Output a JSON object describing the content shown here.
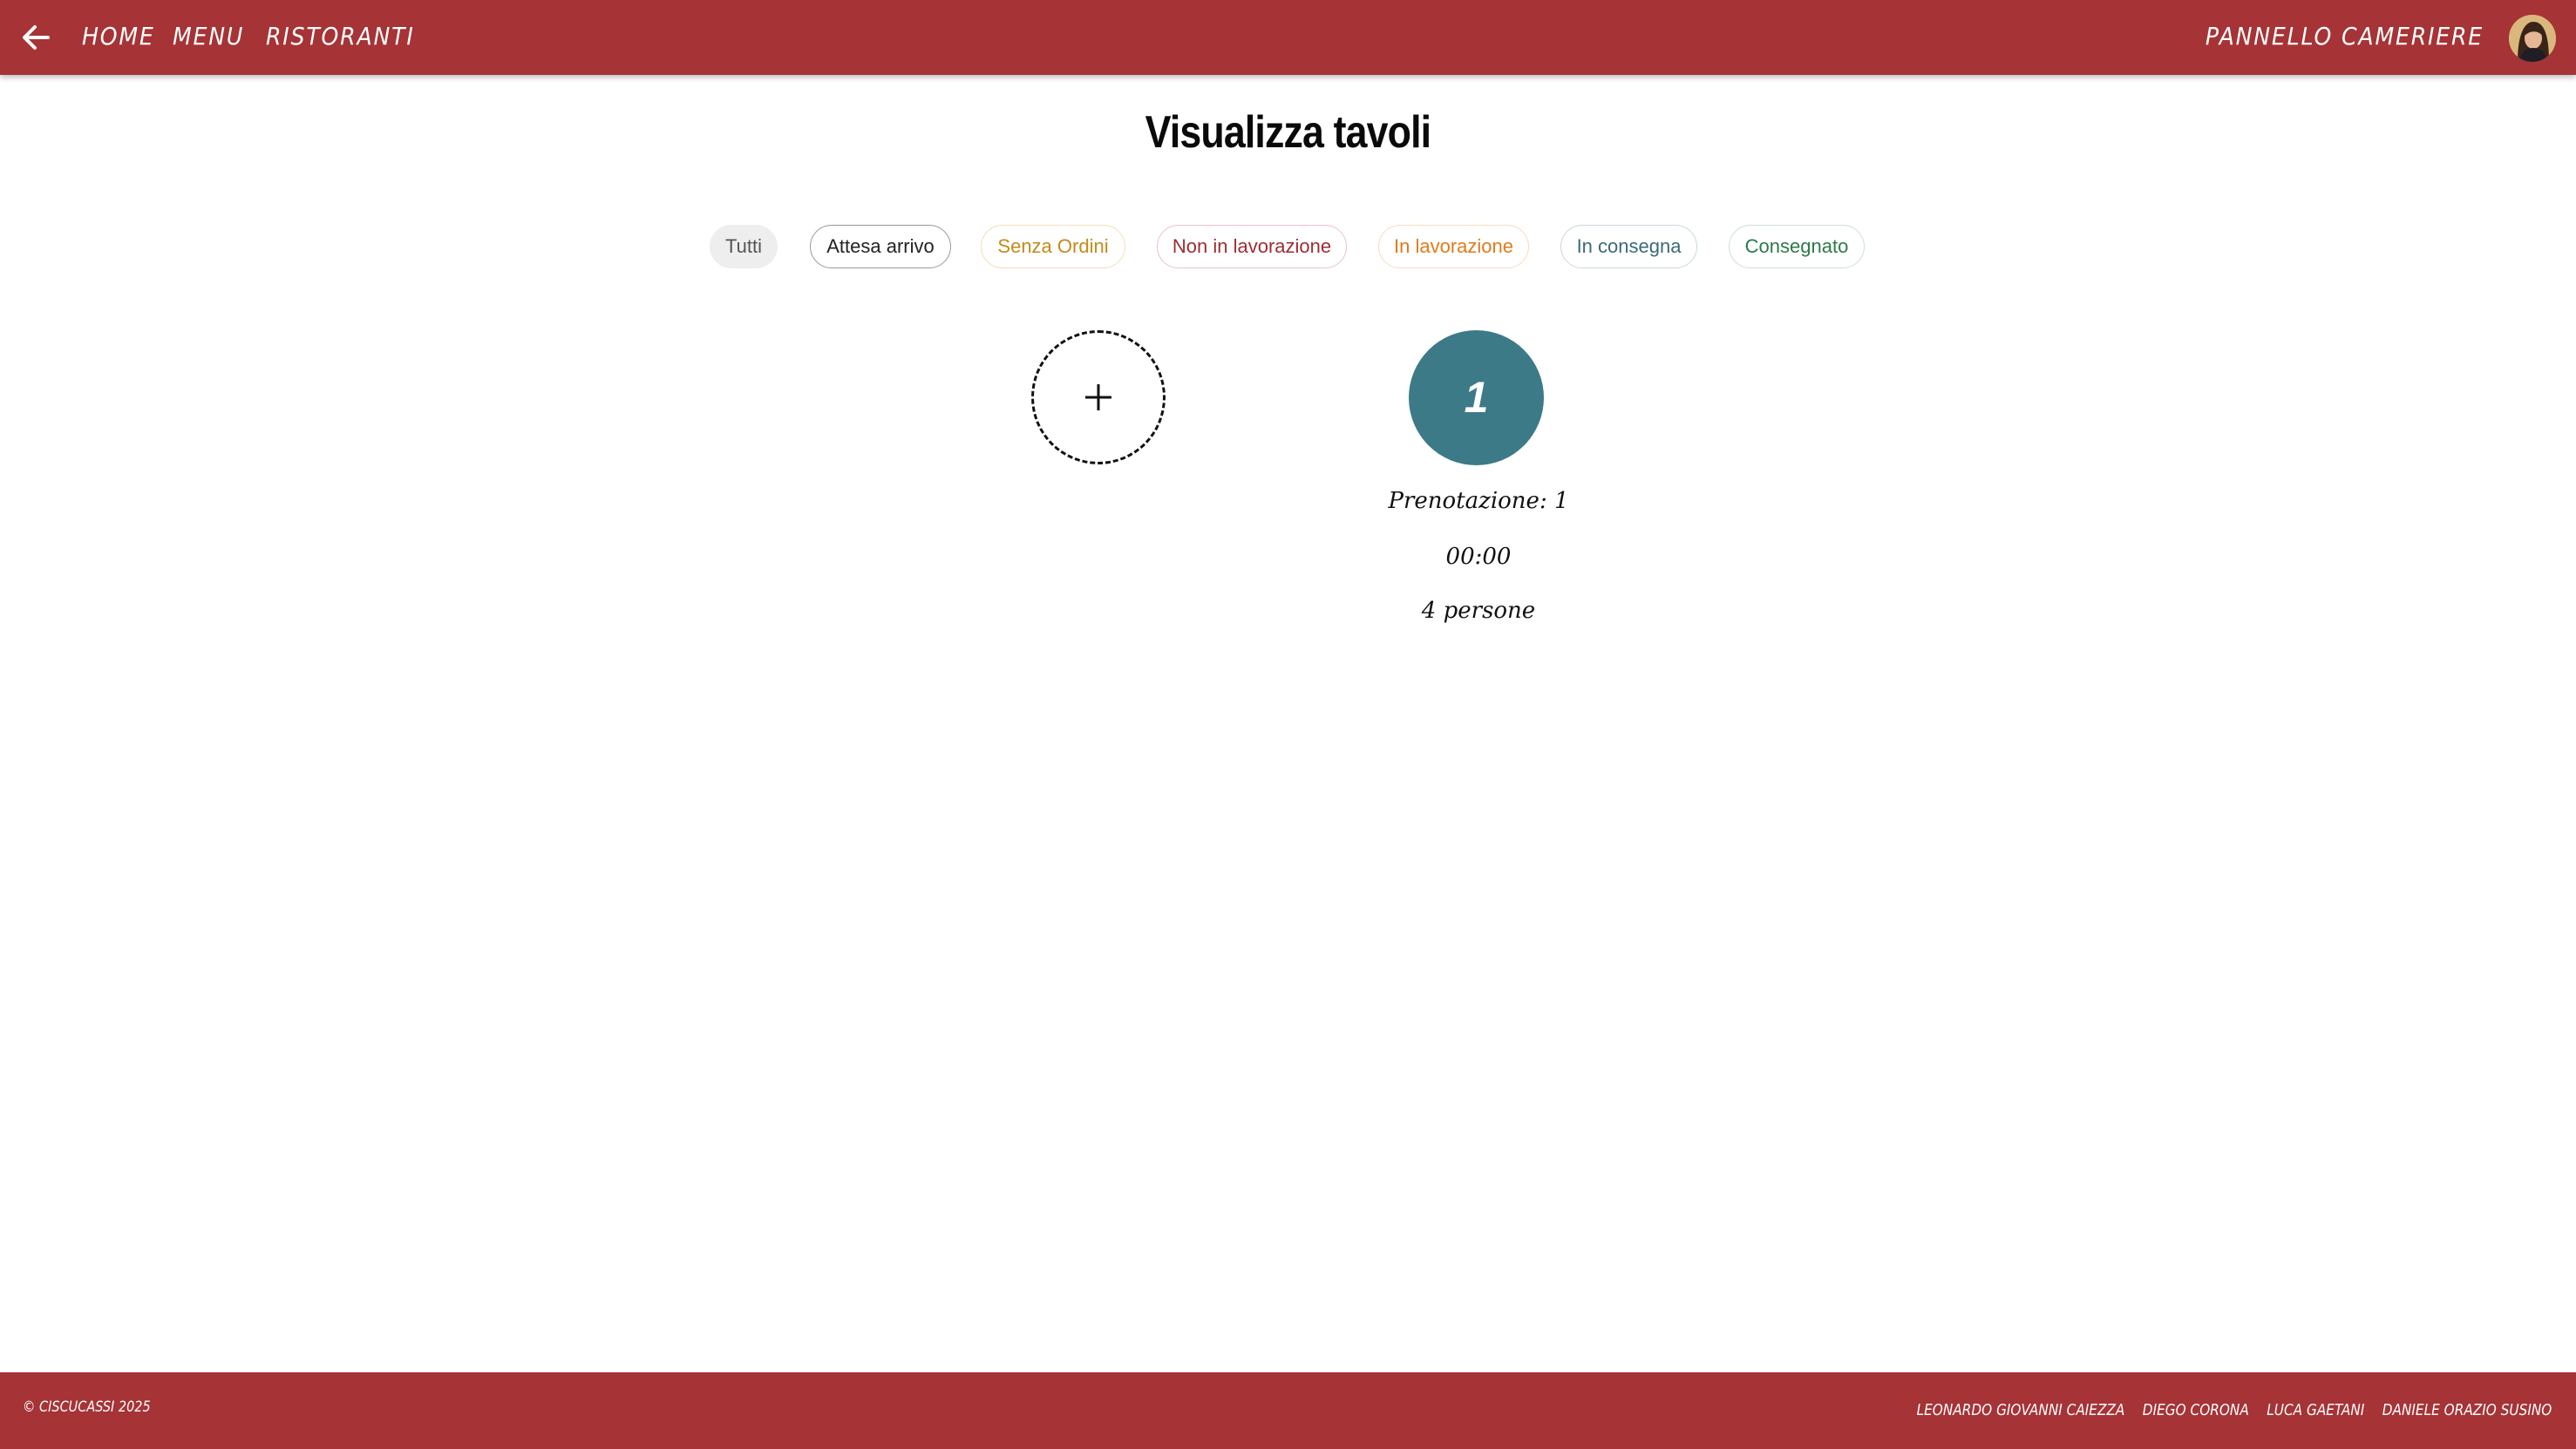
{
  "header": {
    "nav": {
      "home": "Home",
      "menu": "Menu",
      "ristoranti": "Ristoranti"
    },
    "panel_title": "Pannello Cameriere",
    "brand_color": "#a63336"
  },
  "main": {
    "title": "Visualizza tavoli",
    "filters": [
      {
        "label": "Tutti",
        "color": "#555555"
      },
      {
        "label": "Attesa arrivo",
        "color": "#222222"
      },
      {
        "label": "Senza Ordini",
        "color": "#c48a1a"
      },
      {
        "label": "Non in lavorazione",
        "color": "#9e2d33"
      },
      {
        "label": "In lavorazione",
        "color": "#e07b1a"
      },
      {
        "label": "In consegna",
        "color": "#3b6a78"
      },
      {
        "label": "Consegnato",
        "color": "#2c7a49"
      }
    ],
    "add_table_icon": "plus-icon",
    "tables": [
      {
        "number": "1",
        "prenotazione": "Prenotazione: 1",
        "time": "00:00",
        "persone": "4 persone",
        "color": "#3d7a88"
      }
    ]
  },
  "footer": {
    "copyright": "© CiscuCassi 2025",
    "authors": [
      "Leonardo Giovanni Caiezza",
      "Diego Corona",
      "Luca Gaetani",
      "Daniele Orazio Susino"
    ]
  }
}
